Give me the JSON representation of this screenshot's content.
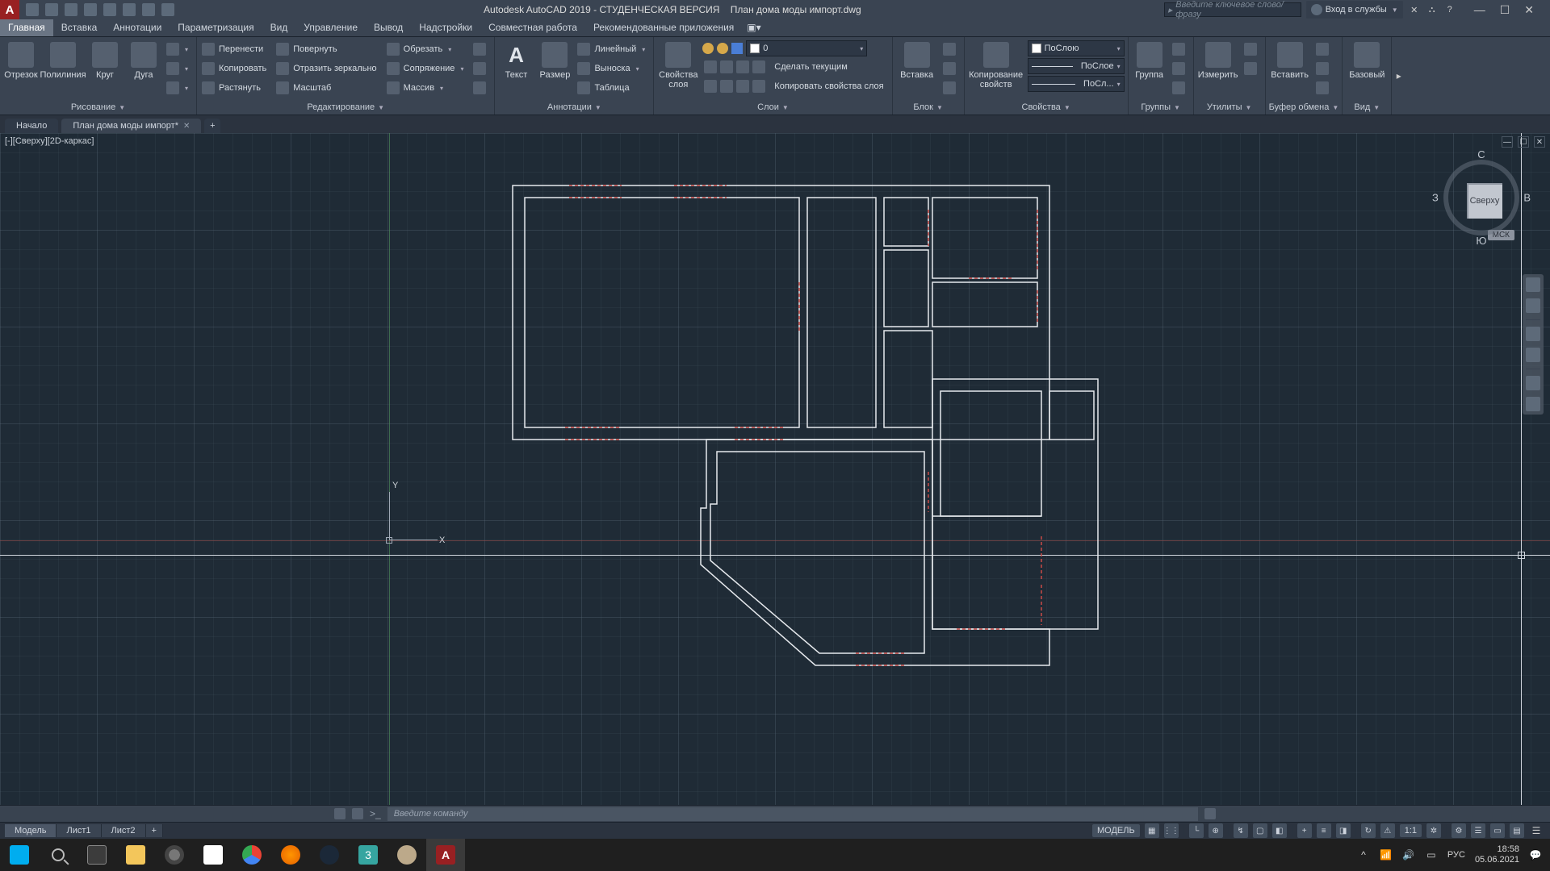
{
  "title": {
    "app": "Autodesk AutoCAD 2019 - СТУДЕНЧЕСКАЯ ВЕРСИЯ",
    "file": "План дома моды импорт.dwg",
    "search_placeholder": "Введите ключевое слово/фразу",
    "signin": "Вход в службы"
  },
  "menu": [
    "Главная",
    "Вставка",
    "Аннотации",
    "Параметризация",
    "Вид",
    "Управление",
    "Вывод",
    "Надстройки",
    "Совместная работа",
    "Рекомендованные приложения"
  ],
  "ribbon": {
    "draw": {
      "title": "Рисование",
      "segment": "Отрезок",
      "polyline": "Полилиния",
      "circle": "Круг",
      "arc": "Дуга"
    },
    "modify": {
      "title": "Редактирование",
      "move": "Перенести",
      "rotate": "Повернуть",
      "trim": "Обрезать",
      "copy": "Копировать",
      "mirror": "Отразить зеркально",
      "fillet": "Сопряжение",
      "stretch": "Растянуть",
      "scale": "Масштаб",
      "array": "Массив"
    },
    "annot": {
      "title": "Аннотации",
      "text": "Текст",
      "dim": "Размер",
      "linear": "Линейный",
      "leader": "Выноска",
      "table": "Таблица"
    },
    "layers": {
      "title": "Слои",
      "props": "Свойства слоя",
      "value": "0",
      "make": "Сделать текущим",
      "copy": "Копировать свойства слоя"
    },
    "block": {
      "title": "Блок",
      "insert": "Вставка"
    },
    "props": {
      "title": "Свойства",
      "copyprops": "Копирование свойств",
      "bylayer": "ПоСлою",
      "bylayer2": "ПоСлое",
      "bylayer3": "ПоСл..."
    },
    "groups": {
      "title": "Группы",
      "group": "Группа"
    },
    "utils": {
      "title": "Утилиты",
      "measure": "Измерить"
    },
    "clipboard": {
      "title": "Буфер обмена",
      "paste": "Вставить"
    },
    "view": {
      "title": "Вид",
      "base": "Базовый"
    }
  },
  "docTabs": {
    "start": "Начало",
    "doc": "План дома моды импорт*"
  },
  "viewport": {
    "label": "[-][Сверху][2D-каркас]",
    "cube_face": "Сверху",
    "north": "С",
    "south": "Ю",
    "east": "В",
    "west": "З",
    "wcs": "МСК",
    "ucs_x": "X",
    "ucs_y": "Y"
  },
  "cmd": {
    "placeholder": "Введите команду"
  },
  "layoutTabs": {
    "model": "Модель",
    "l1": "Лист1",
    "l2": "Лист2"
  },
  "status": {
    "model": "МОДЕЛЬ",
    "scale": "1:1"
  },
  "taskbar": {
    "time": "18:58",
    "date": "05.06.2021",
    "lang": "РУС"
  }
}
